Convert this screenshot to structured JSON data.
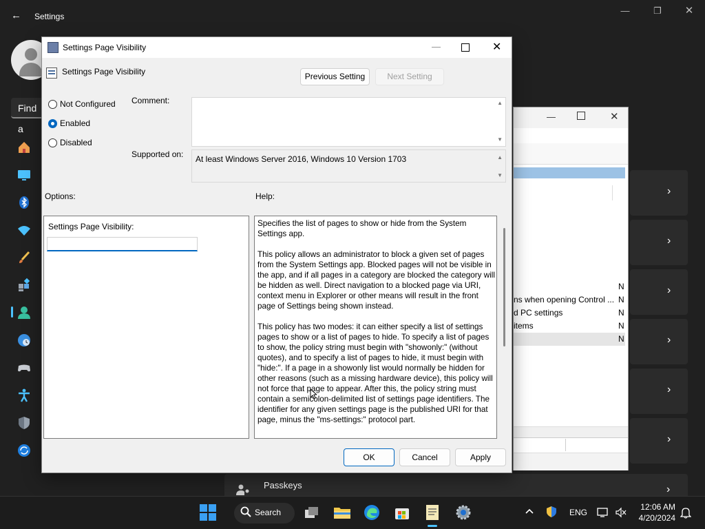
{
  "settings": {
    "window_title": "Settings",
    "search_partial": "Find a",
    "passkeys_label": "Passkeys"
  },
  "gpe": {
    "rows": [
      {
        "text": "",
        "state": "N"
      },
      {
        "text": "ns when opening Control ...",
        "state": "N"
      },
      {
        "text": "d PC settings",
        "state": "N"
      },
      {
        "text": "items",
        "state": "N"
      },
      {
        "text": "",
        "state": "N"
      }
    ]
  },
  "dialog": {
    "title": "Settings Page Visibility",
    "header_title": "Settings Page Visibility",
    "prev_label": "Previous Setting",
    "next_label": "Next Setting",
    "radios": [
      {
        "label": "Not Configured",
        "checked": false
      },
      {
        "label": "Enabled",
        "checked": true
      },
      {
        "label": "Disabled",
        "checked": false
      }
    ],
    "comment_label": "Comment:",
    "supported_label": "Supported on:",
    "supported_value": "At least Windows Server 2016, Windows 10 Version 1703",
    "options_label": "Options:",
    "help_label": "Help:",
    "option_name": "Settings Page Visibility:",
    "option_value": "",
    "help_paragraphs": [
      "Specifies the list of pages to show or hide from the System Settings app.",
      "This policy allows an administrator to block a given set of pages from the System Settings app. Blocked pages will not be visible in the app, and if all pages in a category are blocked the category will be hidden as well. Direct navigation to a blocked page via URI, context menu in Explorer or other means will result in the front page of Settings being shown instead.",
      "This policy has two modes: it can either specify a list of settings pages to show or a list of pages to hide. To specify a list of pages to show, the policy string must begin with \"showonly:\" (without quotes), and to specify a list of pages to hide, it must begin with \"hide:\". If a page in a showonly list would normally be hidden for other reasons (such as a missing hardware device), this policy will not force that page to appear. After this, the policy string must contain a semicolon-delimited list of settings page identifiers. The identifier for any given settings page is the published URI for that page, minus the \"ms-settings:\" protocol part."
    ],
    "ok_label": "OK",
    "cancel_label": "Cancel",
    "apply_label": "Apply"
  },
  "taskbar": {
    "search_label": "Search",
    "language": "ENG",
    "time": "12:06 AM",
    "date": "4/20/2024"
  },
  "icons": {
    "back": "back-arrow-icon",
    "home": "home-icon",
    "system": "system-icon",
    "bluetooth": "bluetooth-icon",
    "network": "wifi-icon",
    "personalization": "brush-icon",
    "apps": "apps-icon",
    "accounts": "accounts-icon",
    "time": "clock-globe-icon",
    "gaming": "gamepad-icon",
    "accessibility": "accessibility-icon",
    "privacy": "shield-icon",
    "update": "update-icon"
  },
  "colors": {
    "accent": "#0067c0",
    "settings_bg": "#202020",
    "nav_indicator": "#4cc2ff",
    "gpe_selection": "#9cc2e5"
  }
}
